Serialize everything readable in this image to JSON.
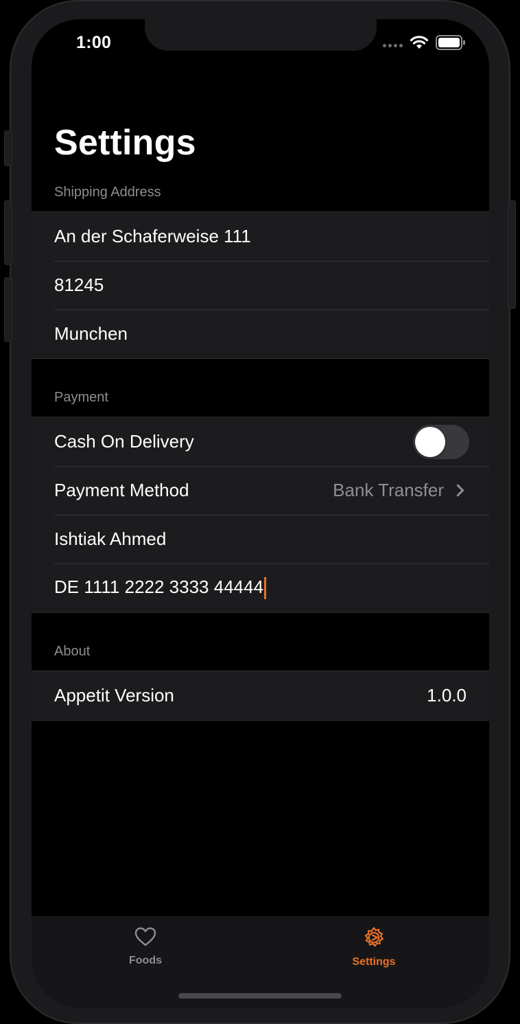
{
  "status_bar": {
    "time": "1:00"
  },
  "page": {
    "title": "Settings"
  },
  "sections": {
    "shipping": {
      "header": "Shipping Address",
      "street": "An der Schaferweise 111",
      "postal_code": "81245",
      "city": "Munchen"
    },
    "payment": {
      "header": "Payment",
      "cash_on_delivery_label": "Cash On Delivery",
      "cash_on_delivery_enabled": false,
      "method_label": "Payment Method",
      "method_value": "Bank Transfer",
      "account_holder": "Ishtiak Ahmed",
      "iban": "DE 1111 2222 3333 44444"
    },
    "about": {
      "header": "About",
      "version_label": "Appetit Version",
      "version_value": "1.0.0"
    }
  },
  "tab_bar": {
    "tabs": [
      {
        "label": "Foods",
        "icon": "heart-icon",
        "selected": false
      },
      {
        "label": "Settings",
        "icon": "gear-icon",
        "selected": true
      }
    ]
  },
  "colors": {
    "accent": "#e8712a",
    "background": "#000000",
    "cell_background": "#1c1c1e",
    "secondary_text": "#8e8e93",
    "tab_inactive": "#8e8e93"
  }
}
